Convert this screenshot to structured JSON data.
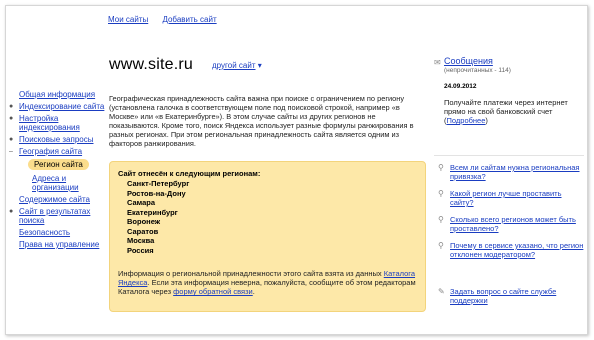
{
  "topnav": {
    "my_sites": "Мои сайты",
    "add_site": "Добавить сайт"
  },
  "site": {
    "name": "www.site.ru",
    "other_site": "другой сайт",
    "other_site_arrow": "▾"
  },
  "sidebar": {
    "items": [
      {
        "label": "Общая информация"
      },
      {
        "label": "Индексирование сайта"
      },
      {
        "label": "Настройка индексирования"
      },
      {
        "label": "Поисковые запросы"
      },
      {
        "label": "География сайта"
      },
      {
        "label": "Регион сайта"
      },
      {
        "label": "Адреса и организации"
      },
      {
        "label": "Содержимое сайта"
      },
      {
        "label": "Сайт в результатах поиска"
      },
      {
        "label": "Безопасность"
      },
      {
        "label": "Права на управление"
      }
    ]
  },
  "description": "Географическая принадлежность сайта важна при поиске с ограничением по региону (установлена галочка в соответствующем поле под поисковой строкой, например «в Москве» или «в Екатеринбурге»). В этом случае сайты из других регионов не показываются. Кроме того, поиск Яндекса использует разные формулы ранжирования в разных регионах. При этом региональная принадлежность сайта является одним из факторов ранжирования.",
  "regions": {
    "heading": "Сайт отнесён к следующим регионам:",
    "list": [
      "Санкт-Петербург",
      "Ростов-на-Дону",
      "Самара",
      "Екатеринбург",
      "Воронеж",
      "Саратов",
      "Москва",
      "Россия"
    ],
    "info_before": "Информация о региональной принадлежности этого сайта взята из данных ",
    "info_link": "Каталога Яндекса",
    "info_middle": ". Если эта информация неверна, пожалуйста, сообщите об этом редакторам Каталога через ",
    "info_form": "форму обратной связи",
    "info_end": "."
  },
  "messages": {
    "title": "Сообщения",
    "unread": "(непрочитанных - 114)",
    "date": "24.09.2012",
    "text_before": "Получайте платежи через интернет прямо на свой банковский счет (",
    "text_link": "Подробнее",
    "text_after": ")"
  },
  "faq": [
    "Всем ли сайтам нужна региональная привязка?",
    "Какой регион лучше проставить сайту?",
    "Сколько всего регионов может быть проставлено?",
    "Почему в сервисе указано, что регион отклонен модератором?"
  ],
  "support": "Задать вопрос о сайте службе поддержки"
}
